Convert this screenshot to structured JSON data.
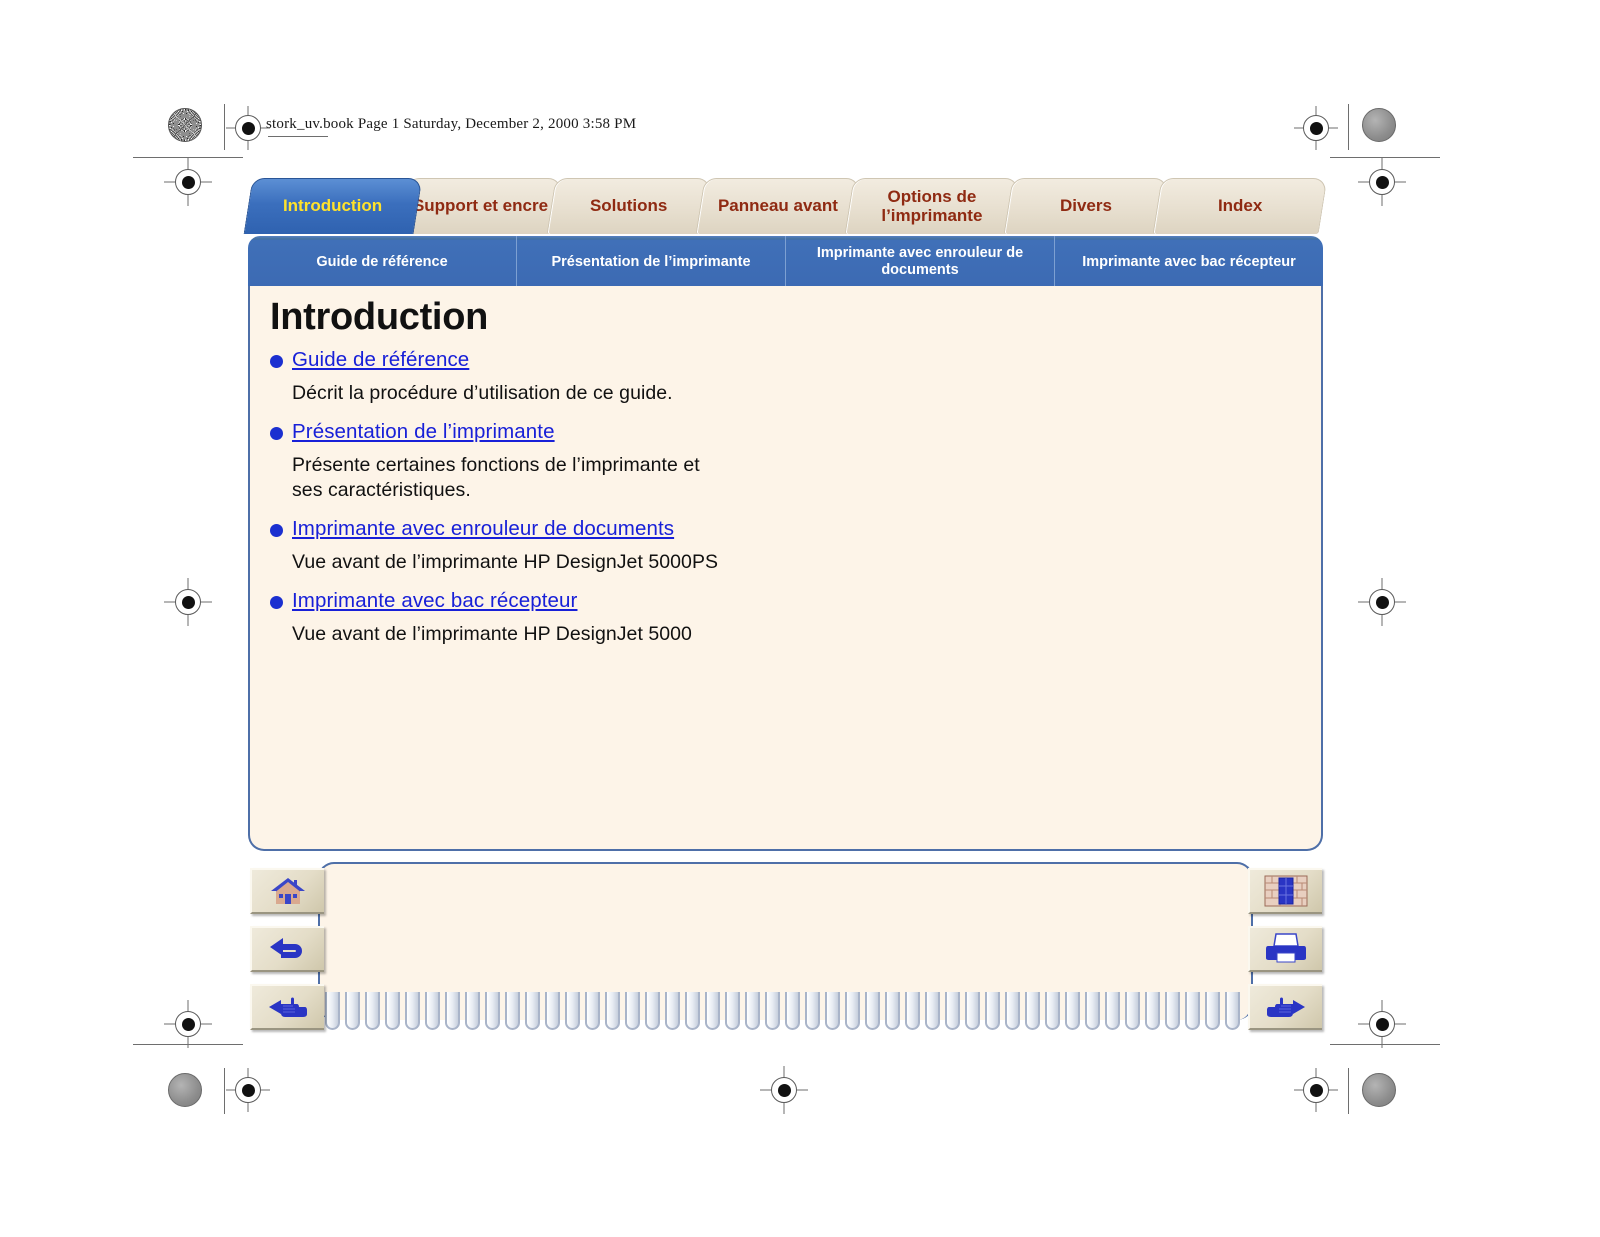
{
  "header": {
    "file_line": "stork_uv.book  Page 1  Saturday, December 2, 2000  3:58 PM"
  },
  "tabs": [
    {
      "label": "Introduction",
      "active": true
    },
    {
      "label": "Support et encre",
      "active": false
    },
    {
      "label": "Solutions",
      "active": false
    },
    {
      "label": "Panneau avant",
      "active": false
    },
    {
      "label": "Options de l’imprimante",
      "active": false
    },
    {
      "label": "Divers",
      "active": false
    },
    {
      "label": "Index",
      "active": false
    }
  ],
  "subnav": [
    {
      "label": "Guide de référence"
    },
    {
      "label": "Présentation de l’imprimante"
    },
    {
      "label": "Imprimante avec enrouleur de documents"
    },
    {
      "label": "Imprimante avec bac récepteur"
    }
  ],
  "page": {
    "title": "Introduction",
    "entries": [
      {
        "link": "Guide de référence",
        "desc": "Décrit la procédure d’utilisation de ce guide."
      },
      {
        "link": "Présentation de l’imprimante",
        "desc": "Présente certaines fonctions de l’imprimante et ses caractéristiques."
      },
      {
        "link": "Imprimante avec enrouleur de documents",
        "desc": "Vue avant de l’imprimante HP DesignJet 5000PS"
      },
      {
        "link": "Imprimante avec bac récepteur",
        "desc": "Vue avant de l’imprimante HP DesignJet 5000"
      }
    ]
  },
  "nav_buttons": {
    "left": [
      {
        "icon": "home-icon",
        "name": "home-button"
      },
      {
        "icon": "back-arrow-icon",
        "name": "back-button"
      },
      {
        "icon": "hand-pointing-left-icon",
        "name": "previous-page-button"
      }
    ],
    "right": [
      {
        "icon": "bookshelf-icon",
        "name": "index-button"
      },
      {
        "icon": "printer-icon",
        "name": "print-button"
      },
      {
        "icon": "hand-pointing-right-icon",
        "name": "next-page-button"
      }
    ]
  },
  "colors": {
    "tab_active_bg": "#3b6fbd",
    "tab_active_text": "#ffe22b",
    "tab_inactive_bg": "#e9e1d2",
    "tab_inactive_text": "#8f2a12",
    "subnav_bg": "#3c6ab3",
    "panel_bg": "#fdf4e8",
    "panel_border": "#4e6fa8",
    "link": "#1820d8",
    "bullet": "#1b2fd0"
  }
}
